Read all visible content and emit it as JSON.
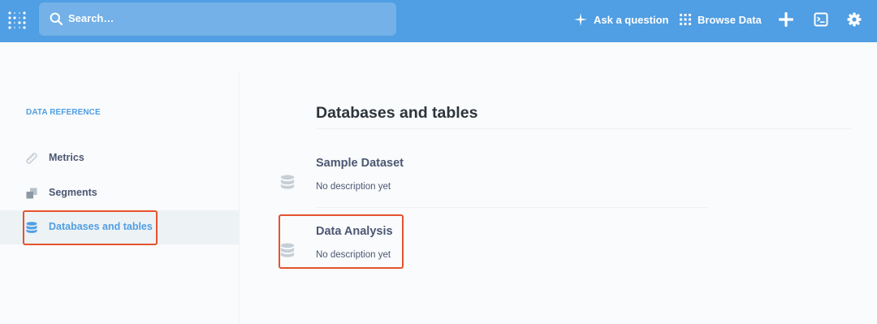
{
  "topbar": {
    "search_placeholder": "Search…",
    "ask_label": "Ask a question",
    "browse_label": "Browse Data",
    "icons": {
      "logo": "metabase-logo-icon",
      "search": "search-icon",
      "ask": "sparkle-icon",
      "browse": "grid-icon",
      "new": "plus-icon",
      "sql": "sql-editor-icon",
      "settings": "gear-icon"
    },
    "bg_color": "#509ee3"
  },
  "sidebar": {
    "heading": "DATA REFERENCE",
    "items": [
      {
        "label": "Metrics",
        "icon": "ruler-icon",
        "active": false
      },
      {
        "label": "Segments",
        "icon": "segment-icon",
        "active": false
      },
      {
        "label": "Databases and tables",
        "icon": "database-icon",
        "active": true
      }
    ],
    "accent_color": "#509ee3"
  },
  "main": {
    "title": "Databases and tables",
    "databases": [
      {
        "name": "Sample Dataset",
        "description": "No description yet",
        "icon": "database-icon"
      },
      {
        "name": "Data Analysis",
        "description": "No description yet",
        "icon": "database-icon"
      }
    ]
  },
  "annotations": {
    "highlight_color": "#e5532e"
  }
}
